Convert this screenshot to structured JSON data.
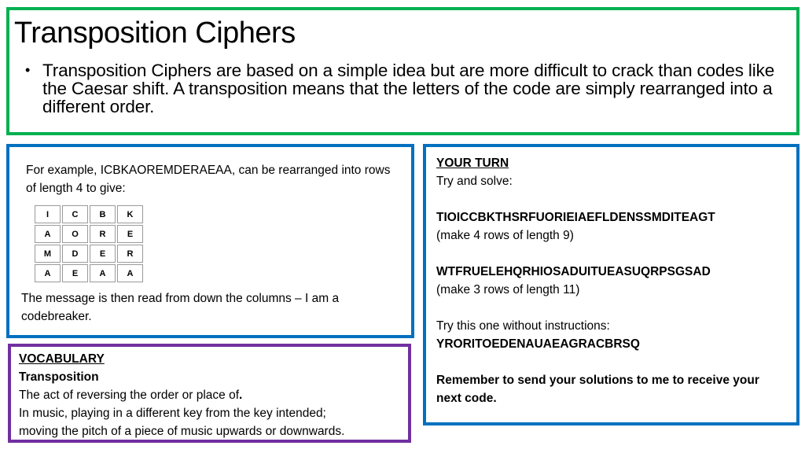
{
  "header": {
    "title": "Transposition Ciphers",
    "bullet_icon": "bullet-dot",
    "bullet_text": "Transposition Ciphers are based on a simple idea but are more difficult to crack than codes like the Caesar shift.  A transposition means that the letters of the code are simply rearranged into a different order."
  },
  "example": {
    "intro": "For example, ICBKAOREMDERAEAA, can be rearranged into rows of length 4 to give:",
    "grid": [
      [
        "I",
        "C",
        "B",
        "K"
      ],
      [
        "A",
        "O",
        "R",
        "E"
      ],
      [
        "M",
        "D",
        "E",
        "R"
      ],
      [
        "A",
        "E",
        "A",
        "A"
      ]
    ],
    "conclusion": "The message is then read from down the columns – I am a codebreaker."
  },
  "vocabulary": {
    "heading": "VOCABULARY",
    "term": "Transposition",
    "definition_1": "The act of reversing the order or place of",
    "definition_1_end": ".",
    "definition_2": "In music, playing in a different key from the key intended;",
    "definition_3": "moving the pitch of a piece of music upwards or downwards."
  },
  "your_turn": {
    "heading": "YOUR TURN",
    "prompt": "Try and solve:",
    "puzzle_1": "TIOICCBKTHSRFUORIEIAEFLDENSSMDITEAGT",
    "puzzle_1_hint": "(make 4 rows of length 9)",
    "puzzle_2": "WTFRUELEHQRHIOSADUITUEASUQRPSGSAD",
    "puzzle_2_hint": "(make 3 rows of length 11)",
    "puzzle_3_prompt": "Try this one without instructions:",
    "puzzle_3": "YRORITOEDENAUAEAGRACBRSQ",
    "reminder": "Remember to send your solutions to me to receive your next code."
  },
  "colors": {
    "header_border": "#00b050",
    "example_border": "#0070c0",
    "vocab_border": "#7030a0",
    "turn_border": "#0070c0",
    "grid_border": "#9a9a9a"
  }
}
